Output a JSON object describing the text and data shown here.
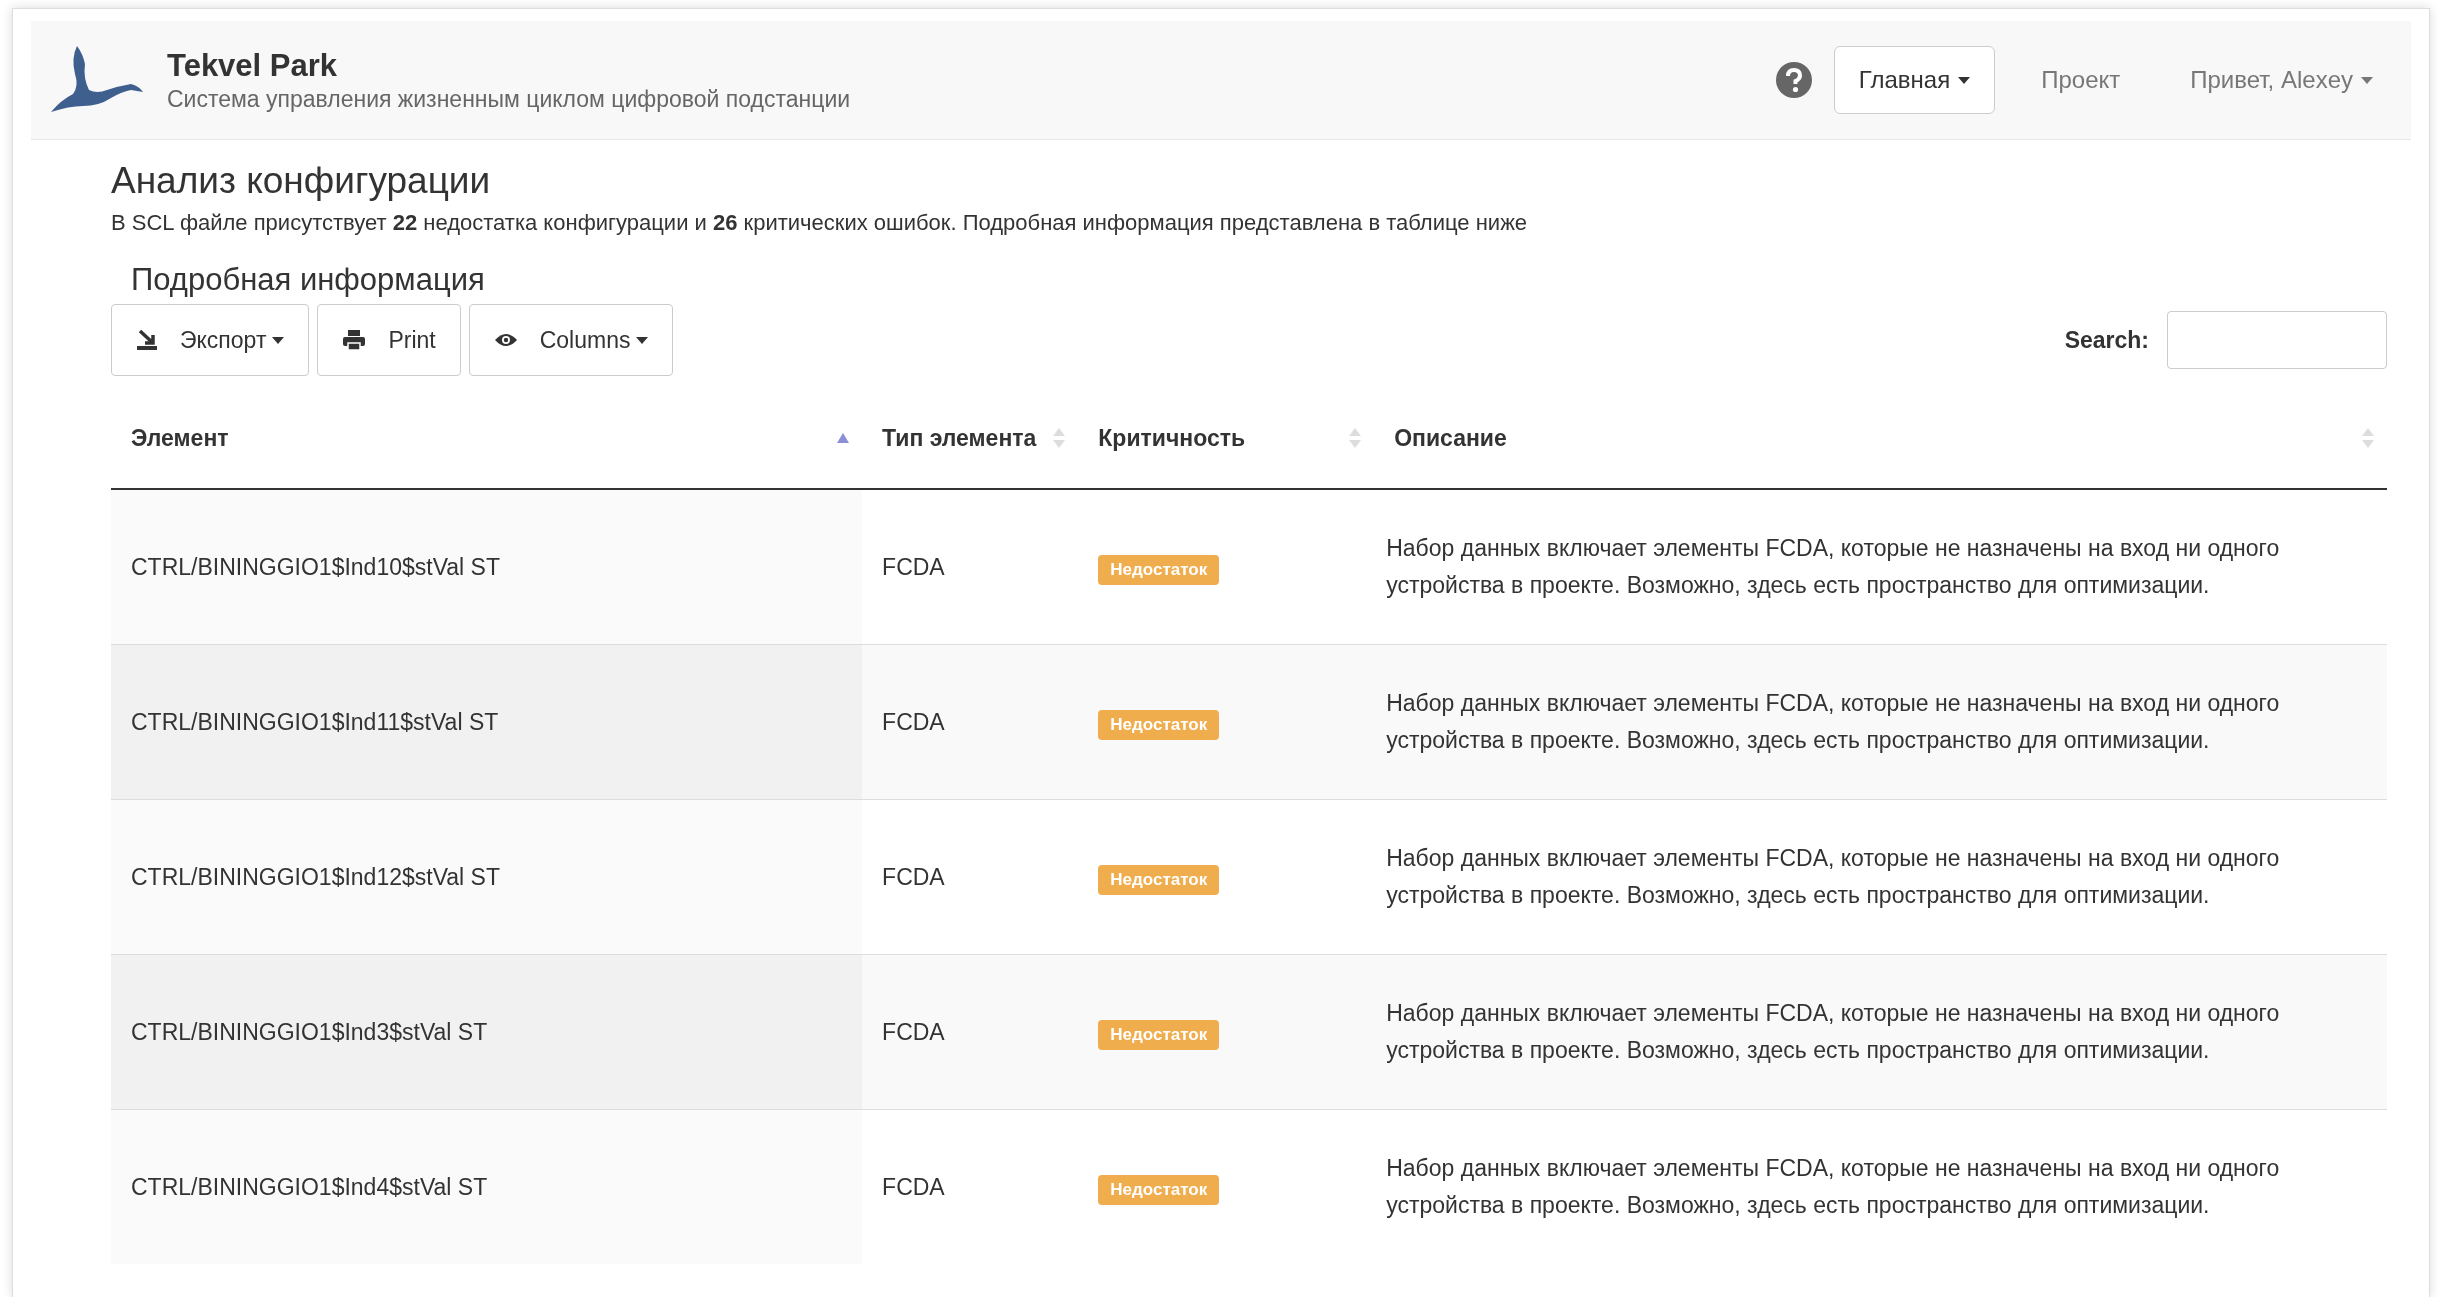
{
  "brand": {
    "title": "Tekvel Park",
    "subtitle": "Система управления жизненным циклом цифровой подстанции"
  },
  "nav": [
    {
      "kind": "button",
      "label": "Главная",
      "caret": true
    },
    {
      "kind": "link",
      "label": "Проект",
      "caret": false
    },
    {
      "kind": "link",
      "label": "Привет, Alexey",
      "caret": true
    }
  ],
  "page": {
    "title": "Анализ конфигурации",
    "summary": "В SCL файле присутствует **22** недостатка конфигурации и **26** критических ошибок. Подробная информация представлена в таблице ниже",
    "section": "Подробная информация"
  },
  "toolbar": [
    {
      "label": "Экспорт",
      "caret": true
    },
    {
      "label": "Print",
      "caret": false
    },
    {
      "label": "Columns",
      "caret": true
    }
  ],
  "search": {
    "label": "Search:"
  },
  "table": {
    "columns": [
      {
        "label": "Элемент",
        "sorted": true
      },
      {
        "label": "Тип элемента",
        "sorted": false
      },
      {
        "label": "Критичность",
        "sorted": false
      },
      {
        "label": "Описание",
        "sorted": false
      }
    ],
    "rows": [
      {
        "element": "CTRL/BININGGIO1$Ind10$stVal ST",
        "type": "FCDA",
        "severity": "Недостаток",
        "color": "#f0ad4e",
        "description": "Набор данных включает элементы FCDA, которые не назначены на вход ни одного устройства в проекте. Возможно, здесь есть пространство для оптимизации."
      },
      {
        "element": "CTRL/BININGGIO1$Ind11$stVal ST",
        "type": "FCDA",
        "severity": "Недостаток",
        "color": "#f0ad4e",
        "description": "Набор данных включает элементы FCDA, которые не назначены на вход ни одного устройства в проекте. Возможно, здесь есть пространство для оптимизации."
      },
      {
        "element": "CTRL/BININGGIO1$Ind12$stVal ST",
        "type": "FCDA",
        "severity": "Недостаток",
        "color": "#f0ad4e",
        "description": "Набор данных включает элементы FCDA, которые не назначены на вход ни одного устройства в проекте. Возможно, здесь есть пространство для оптимизации."
      },
      {
        "element": "CTRL/BININGGIO1$Ind3$stVal ST",
        "type": "FCDA",
        "severity": "Недостаток",
        "color": "#f0ad4e",
        "description": "Набор данных включает элементы FCDA, которые не назначены на вход ни одного устройства в проекте. Возможно, здесь есть пространство для оптимизации."
      },
      {
        "element": "CTRL/BININGGIO1$Ind4$stVal ST",
        "type": "FCDA",
        "severity": "Недостаток",
        "color": "#f0ad4e",
        "description": "Набор данных включает элементы FCDA, которые не назначены на вход ни одного устройства в проекте. Возможно, здесь есть пространство для оптимизации."
      }
    ]
  }
}
